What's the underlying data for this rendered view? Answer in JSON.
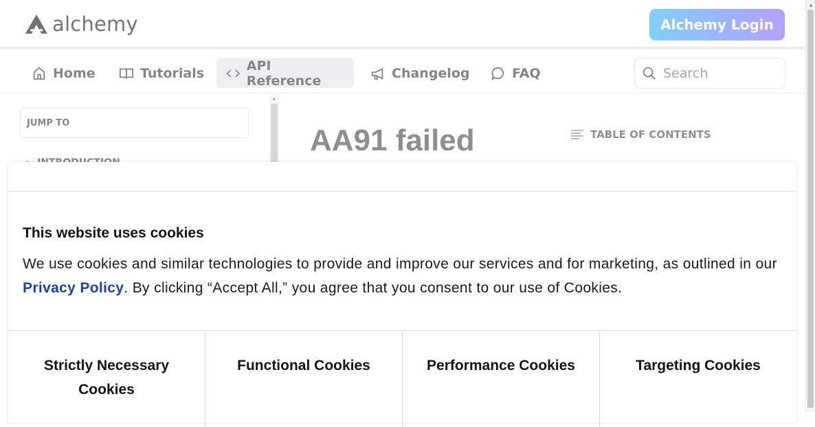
{
  "header": {
    "logo_text": "alchemy",
    "login_label": "Alchemy Login"
  },
  "nav": {
    "items": [
      {
        "label": "Home",
        "icon": "home-icon"
      },
      {
        "label": "Tutorials",
        "icon": "book-icon"
      },
      {
        "label": "API Reference",
        "icon": "code-icon",
        "active": true
      },
      {
        "label": "Changelog",
        "icon": "megaphone-icon"
      },
      {
        "label": "FAQ",
        "icon": "chat-bubble-icon"
      }
    ],
    "search_placeholder": "Search"
  },
  "sidebar": {
    "jump_to": "JUMP TO",
    "first_section": "INTRODUCTION"
  },
  "main": {
    "title": "AA91 failed",
    "toc_label": "TABLE OF CONTENTS"
  },
  "cookie_modal": {
    "title": "This website uses cookies",
    "text_before_link": "We use cookies and similar technologies to provide and improve our services and for marketing, as outlined in our ",
    "link_text": "Privacy Policy",
    "text_after_link": ". By clicking “Accept All,” you agree that you consent to our use of Cookies.",
    "categories": [
      "Strictly Necessary Cookies",
      "Functional Cookies",
      "Performance Cookies",
      "Targeting Cookies"
    ]
  },
  "colors": {
    "login_gradient_start": "#35b3f2",
    "login_gradient_end": "#8a66f5",
    "link": "#1c3fb5"
  }
}
